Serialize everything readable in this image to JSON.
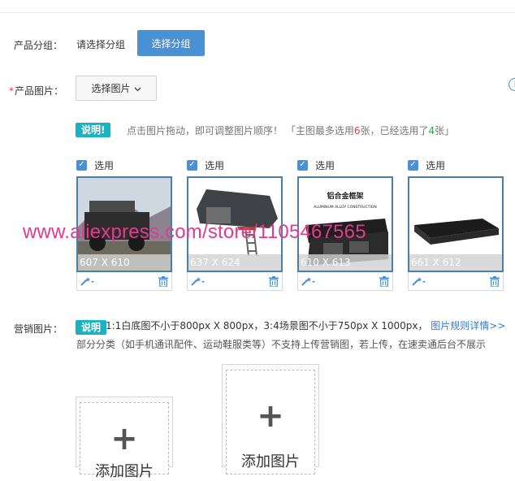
{
  "form": {
    "group": {
      "label": "产品分组：",
      "placeholder": "请选择分组",
      "button": "选择分组"
    },
    "images": {
      "required_mark": "*",
      "label": "产品图片：",
      "select_button": "选择图片",
      "tip_badge": "说明!",
      "tip_text_1": "点击图片拖动，即可调整图片顺序！",
      "tip_text_2": "「主图最多选用",
      "tip_max": "6",
      "tip_text_3": "张，已经选用了",
      "tip_used": "4",
      "tip_text_4": "张」",
      "items": [
        {
          "selected_label": "选用",
          "dimensions": "607 X 610"
        },
        {
          "selected_label": "选用",
          "dimensions": "637 X 624"
        },
        {
          "selected_label": "选用",
          "dimensions": "610 X 613",
          "caption_cn": "铝合金框架",
          "caption_en": "ALUMINUM ALLOY CONSTRUCTION"
        },
        {
          "selected_label": "选用",
          "dimensions": "661 X 612"
        }
      ]
    },
    "marketing": {
      "label": "营销图片：",
      "tip_badge": "说明",
      "tip_text_1": "1:1白底图不小于800px X 800px，3:4场景图不小于750px X 1000px，",
      "tip_link": "图片规则详情>>",
      "tip_text_2": "部分分类（如手机通讯配件、运动鞋服类等）不支持上传营销图，若上传，在速卖通后台不展示",
      "upload_1": "添加图片",
      "upload_2": "添加图片"
    }
  },
  "watermark": "www.aliexpress.com/store/1105467565",
  "colors": {
    "primary": "#4a90d4",
    "badge": "#17b3c0",
    "required": "#e4393c",
    "watermark": "#e23a8c"
  },
  "icons": [
    "chevron-down-icon",
    "info-icon",
    "checkbox-icon",
    "magic-wand-icon",
    "trash-icon",
    "plus-icon"
  ]
}
